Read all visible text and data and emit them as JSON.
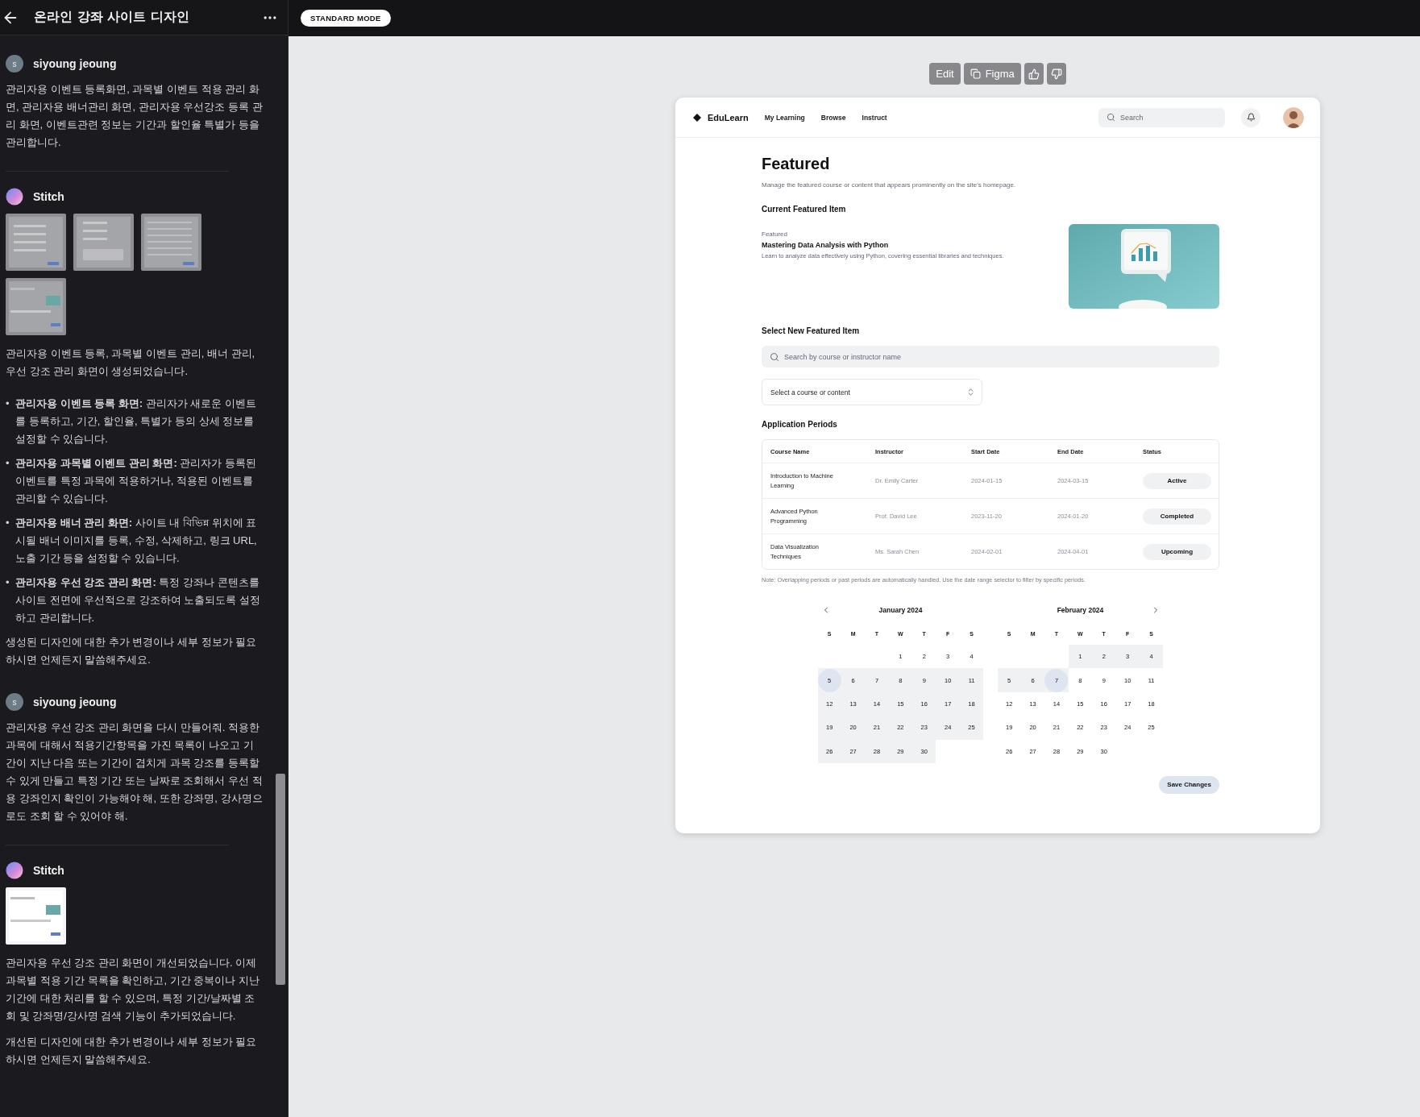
{
  "chat": {
    "title": "온라인 강좌 사이트 디자인",
    "messages": [
      {
        "kind": "user",
        "author": "siyoung jeoung",
        "avatar": "s",
        "blocks": [
          {
            "kind": "paragraph",
            "text": "관리자용 이벤트 등록화면, 과목별 이벤트 적용 관리 화면, 관리자용 배너관리 화면, 관리자용 우선강조 등록 관리 화면, 이벤트관련 정보는 기간과 할인율 특별가 등을 관리합니다."
          }
        ]
      },
      {
        "kind": "assistant",
        "author": "Stitch",
        "blocks": [
          {
            "kind": "thumbnails",
            "items": [
              {
                "kind": "form"
              },
              {
                "kind": "list"
              },
              {
                "kind": "table"
              },
              {
                "kind": "featured"
              }
            ]
          },
          {
            "kind": "paragraph",
            "text": "관리자용 이벤트 등록, 과목별 이벤트 관리, 배너 관리, 우선 강조 관리 화면이 생성되었습니다."
          },
          {
            "kind": "bullets",
            "items": [
              {
                "marker": "•",
                "text": "**관리자용 이벤트 등록 화면:** 관리자가 새로운 이벤트를 등록하고, 기간, 할인율, 특별가 등의 상세 정보를 설정할 수 있습니다."
              },
              {
                "marker": "•",
                "text": "**관리자용 과목별 이벤트 관리 화면:** 관리자가 등록된 이벤트를 특정 과목에 적용하거나, 적용된 이벤트를 관리할 수 있습니다."
              },
              {
                "marker": "•",
                "text": "**관리자용 배너 관리 화면:** 사이트 내 বিভিন্ন 위치에 표시될 배너 이미지를 등록, 수정, 삭제하고, 링크 URL, 노출 기간 등을 설정할 수 있습니다."
              },
              {
                "marker": "•",
                "text": "**관리자용 우선 강조 관리 화면:** 특정 강좌나 콘텐츠를 사이트 전면에 우선적으로 강조하여 노출되도록 설정하고 관리합니다."
              }
            ]
          },
          {
            "kind": "paragraph",
            "text": "생성된 디자인에 대한 추가 변경이나 세부 정보가 필요하시면 언제든지 말씀해주세요."
          }
        ]
      },
      {
        "kind": "user",
        "author": "siyoung jeoung",
        "avatar": "s",
        "blocks": [
          {
            "kind": "paragraph",
            "text": "관리자용 우선 강조 관리 화면을 다시 만들어줘. 적용한 과목에 대해서 적용기간항목을 가진 목록이 나오고 기간이 지난 다음 또는 기간이 겹치게 과목 강조를 등록할 수 있게 만들고 특정 기간 또는 날짜로 조회해서 우선 적용 강좌인지 확인이 가능해야 해, 또한 강좌명, 강사명으로도 조회 할 수 있어야 해."
          }
        ]
      },
      {
        "kind": "assistant",
        "author": "Stitch",
        "blocks": [
          {
            "kind": "thumbnails",
            "items": [
              {
                "kind": "featured"
              }
            ]
          },
          {
            "kind": "paragraph",
            "text": "관리자용 우선 강조 관리 화면이 개선되었습니다. 이제 과목별 적용 기간 목록을 확인하고, 기간 중복이나 지난 기간에 대한 처리를 할 수 있으며, 특정 기간/날짜별 조회 및 강좌명/강사명 검색 기능이 추가되었습니다."
          },
          {
            "kind": "paragraph",
            "text": "개선된 디자인에 대한 추가 변경이나 세부 정보가 필요하시면 언제든지 말씀해주세요."
          }
        ]
      }
    ]
  },
  "mode_badge": "STANDARD MODE",
  "toolbar": [
    {
      "kind": "text",
      "label": "Edit"
    },
    {
      "kind": "figma",
      "label": "Figma"
    },
    {
      "kind": "like"
    },
    {
      "kind": "dislike"
    }
  ],
  "design": {
    "nav": {
      "brand": "EduLearn",
      "links": [
        "My Learning",
        "Browse",
        "Instruct"
      ],
      "search_placeholder": "Search"
    },
    "title": "Featured",
    "subtitle": "Manage the featured course or content that appears prominently on the site's homepage.",
    "current_heading": "Current Featured Item",
    "current": {
      "tag": "Featured",
      "title": "Mastering Data Analysis with Python",
      "description": "Learn to analyze data effectively using Python, covering essential libraries and techniques."
    },
    "select_heading": "Select New Featured Item",
    "search_placeholder": "Search by course or instructor name",
    "dropdown_placeholder": "Select a course or content",
    "periods_heading": "Application Periods",
    "table": {
      "columns": [
        "Course Name",
        "Instructor",
        "Start Date",
        "End Date",
        "Status"
      ],
      "rows": [
        [
          "Introduction to Machine Learning",
          "Dr. Emily Carter",
          "2024-01-15",
          "2024-03-15",
          "Active"
        ],
        [
          "Advanced Python Programming",
          "Prof. David Lee",
          "2023-11-20",
          "2024-01-20",
          "Completed"
        ],
        [
          "Data Visualization Techniques",
          "Ms. Sarah Chen",
          "2024-02-01",
          "2024-04-01",
          "Upcoming"
        ]
      ]
    },
    "note": "Note: Overlapping periods or past periods are automatically handled. Use the date range selector to filter by specific periods.",
    "calendars": [
      {
        "title": "January 2024",
        "weekdays": [
          "S",
          "M",
          "T",
          "W",
          "T",
          "F",
          "S"
        ],
        "weeks": [
          [
            {
              "kind": "blank"
            },
            {
              "kind": "blank"
            },
            {
              "kind": "blank"
            },
            {
              "kind": "day",
              "d": "1",
              "in_range": false,
              "selected": false
            },
            {
              "kind": "day",
              "d": "2",
              "in_range": false,
              "selected": false
            },
            {
              "kind": "day",
              "d": "3",
              "in_range": false,
              "selected": false
            },
            {
              "kind": "day",
              "d": "4",
              "in_range": false,
              "selected": false
            }
          ],
          [
            {
              "kind": "day",
              "d": "5",
              "in_range": true,
              "selected": true
            },
            {
              "kind": "day",
              "d": "6",
              "in_range": true,
              "selected": false
            },
            {
              "kind": "day",
              "d": "7",
              "in_range": true,
              "selected": false
            },
            {
              "kind": "day",
              "d": "8",
              "in_range": true,
              "selected": false
            },
            {
              "kind": "day",
              "d": "9",
              "in_range": true,
              "selected": false
            },
            {
              "kind": "day",
              "d": "10",
              "in_range": true,
              "selected": false
            },
            {
              "kind": "day",
              "d": "11",
              "in_range": true,
              "selected": false
            }
          ],
          [
            {
              "kind": "day",
              "d": "12",
              "in_range": true,
              "selected": false
            },
            {
              "kind": "day",
              "d": "13",
              "in_range": true,
              "selected": false
            },
            {
              "kind": "day",
              "d": "14",
              "in_range": true,
              "selected": false
            },
            {
              "kind": "day",
              "d": "15",
              "in_range": true,
              "selected": false
            },
            {
              "kind": "day",
              "d": "16",
              "in_range": true,
              "selected": false
            },
            {
              "kind": "day",
              "d": "17",
              "in_range": true,
              "selected": false
            },
            {
              "kind": "day",
              "d": "18",
              "in_range": true,
              "selected": false
            }
          ],
          [
            {
              "kind": "day",
              "d": "19",
              "in_range": true,
              "selected": false
            },
            {
              "kind": "day",
              "d": "20",
              "in_range": true,
              "selected": false
            },
            {
              "kind": "day",
              "d": "21",
              "in_range": true,
              "selected": false
            },
            {
              "kind": "day",
              "d": "22",
              "in_range": true,
              "selected": false
            },
            {
              "kind": "day",
              "d": "23",
              "in_range": true,
              "selected": false
            },
            {
              "kind": "day",
              "d": "24",
              "in_range": true,
              "selected": false
            },
            {
              "kind": "day",
              "d": "25",
              "in_range": true,
              "selected": false
            }
          ],
          [
            {
              "kind": "day",
              "d": "26",
              "in_range": true,
              "selected": false
            },
            {
              "kind": "day",
              "d": "27",
              "in_range": true,
              "selected": false
            },
            {
              "kind": "day",
              "d": "28",
              "in_range": true,
              "selected": false
            },
            {
              "kind": "day",
              "d": "29",
              "in_range": true,
              "selected": false
            },
            {
              "kind": "day",
              "d": "30",
              "in_range": true,
              "selected": false
            },
            {
              "kind": "blank"
            },
            {
              "kind": "blank"
            }
          ]
        ]
      },
      {
        "title": "February 2024",
        "weekdays": [
          "S",
          "M",
          "T",
          "W",
          "T",
          "F",
          "S"
        ],
        "weeks": [
          [
            {
              "kind": "blank"
            },
            {
              "kind": "blank"
            },
            {
              "kind": "blank"
            },
            {
              "kind": "day",
              "d": "1",
              "in_range": true,
              "selected": false
            },
            {
              "kind": "day",
              "d": "2",
              "in_range": true,
              "selected": false
            },
            {
              "kind": "day",
              "d": "3",
              "in_range": true,
              "selected": false
            },
            {
              "kind": "day",
              "d": "4",
              "in_range": true,
              "selected": false
            }
          ],
          [
            {
              "kind": "day",
              "d": "5",
              "in_range": true,
              "selected": false
            },
            {
              "kind": "day",
              "d": "6",
              "in_range": true,
              "selected": false
            },
            {
              "kind": "day",
              "d": "7",
              "in_range": true,
              "selected": true
            },
            {
              "kind": "day",
              "d": "8",
              "in_range": false,
              "selected": false
            },
            {
              "kind": "day",
              "d": "9",
              "in_range": false,
              "selected": false
            },
            {
              "kind": "day",
              "d": "10",
              "in_range": false,
              "selected": false
            },
            {
              "kind": "day",
              "d": "11",
              "in_range": false,
              "selected": false
            }
          ],
          [
            {
              "kind": "day",
              "d": "12",
              "in_range": false,
              "selected": false
            },
            {
              "kind": "day",
              "d": "13",
              "in_range": false,
              "selected": false
            },
            {
              "kind": "day",
              "d": "14",
              "in_range": false,
              "selected": false
            },
            {
              "kind": "day",
              "d": "15",
              "in_range": false,
              "selected": false
            },
            {
              "kind": "day",
              "d": "16",
              "in_range": false,
              "selected": false
            },
            {
              "kind": "day",
              "d": "17",
              "in_range": false,
              "selected": false
            },
            {
              "kind": "day",
              "d": "18",
              "in_range": false,
              "selected": false
            }
          ],
          [
            {
              "kind": "day",
              "d": "19",
              "in_range": false,
              "selected": false
            },
            {
              "kind": "day",
              "d": "20",
              "in_range": false,
              "selected": false
            },
            {
              "kind": "day",
              "d": "21",
              "in_range": false,
              "selected": false
            },
            {
              "kind": "day",
              "d": "22",
              "in_range": false,
              "selected": false
            },
            {
              "kind": "day",
              "d": "23",
              "in_range": false,
              "selected": false
            },
            {
              "kind": "day",
              "d": "24",
              "in_range": false,
              "selected": false
            },
            {
              "kind": "day",
              "d": "25",
              "in_range": false,
              "selected": false
            }
          ],
          [
            {
              "kind": "day",
              "d": "26",
              "in_range": false,
              "selected": false
            },
            {
              "kind": "day",
              "d": "27",
              "in_range": false,
              "selected": false
            },
            {
              "kind": "day",
              "d": "28",
              "in_range": false,
              "selected": false
            },
            {
              "kind": "day",
              "d": "29",
              "in_range": false,
              "selected": false
            },
            {
              "kind": "day",
              "d": "30",
              "in_range": false,
              "selected": false
            },
            {
              "kind": "blank"
            },
            {
              "kind": "blank"
            }
          ]
        ]
      }
    ],
    "save_label": "Save Changes"
  }
}
